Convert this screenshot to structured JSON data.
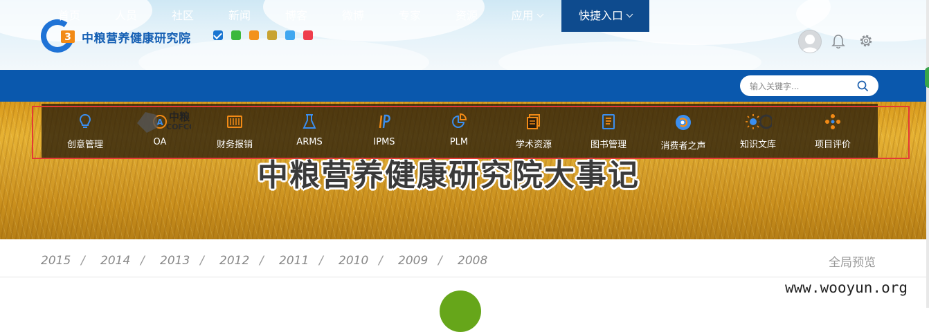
{
  "header": {
    "org_name": "中粮营养健康研究院",
    "theme_swatches": [
      {
        "color": "#1875d1",
        "active": true
      },
      {
        "color": "#3bb83b",
        "active": false
      },
      {
        "color": "#f3921c",
        "active": false
      },
      {
        "color": "#c8a332",
        "active": false
      },
      {
        "color": "#3fa7f0",
        "active": false
      },
      {
        "color": "#ef3d4c",
        "active": false
      }
    ]
  },
  "nav": {
    "items": [
      {
        "label": "首页"
      },
      {
        "label": "人员"
      },
      {
        "label": "社区"
      },
      {
        "label": "新闻"
      },
      {
        "label": "博客"
      },
      {
        "label": "微博"
      },
      {
        "label": "专家"
      },
      {
        "label": "资源"
      },
      {
        "label": "应用"
      },
      {
        "label": "快捷入口"
      }
    ],
    "search_placeholder": "输入关键字..."
  },
  "quick_links": [
    {
      "label": "创意管理",
      "icon": "lightbulb-icon"
    },
    {
      "label": "OA",
      "icon": "oa-logo"
    },
    {
      "label": "财务报销",
      "icon": "abacus-icon"
    },
    {
      "label": "ARMS",
      "icon": "flask-icon"
    },
    {
      "label": "IPMS",
      "icon": "ipms-icon"
    },
    {
      "label": "PLM",
      "icon": "pie-chart-icon"
    },
    {
      "label": "学术资源",
      "icon": "document-stack-icon"
    },
    {
      "label": "图书管理",
      "icon": "book-icon"
    },
    {
      "label": "消费者之声",
      "icon": "consumer-voice-icon"
    },
    {
      "label": "知识文库",
      "icon": "sun-bulb-icon"
    },
    {
      "label": "项目评价",
      "icon": "nodes-icon"
    }
  ],
  "oa_logo_text": "中粮",
  "oa_logo_sub": "COFCO",
  "banner": {
    "title": "中粮营养健康研究院大事记"
  },
  "timeline": {
    "years": [
      "2015",
      "2014",
      "2013",
      "2012",
      "2011",
      "2010",
      "2009",
      "2008"
    ],
    "separator": "/",
    "overview_label": "全局预览"
  },
  "watermark": "www.wooyun.org",
  "colors": {
    "nav_bg": "#0a58ad",
    "nav_active_bg": "#0e4b8e",
    "quick_icon": "#3b8ff0",
    "highlight_border": "#e53935"
  }
}
